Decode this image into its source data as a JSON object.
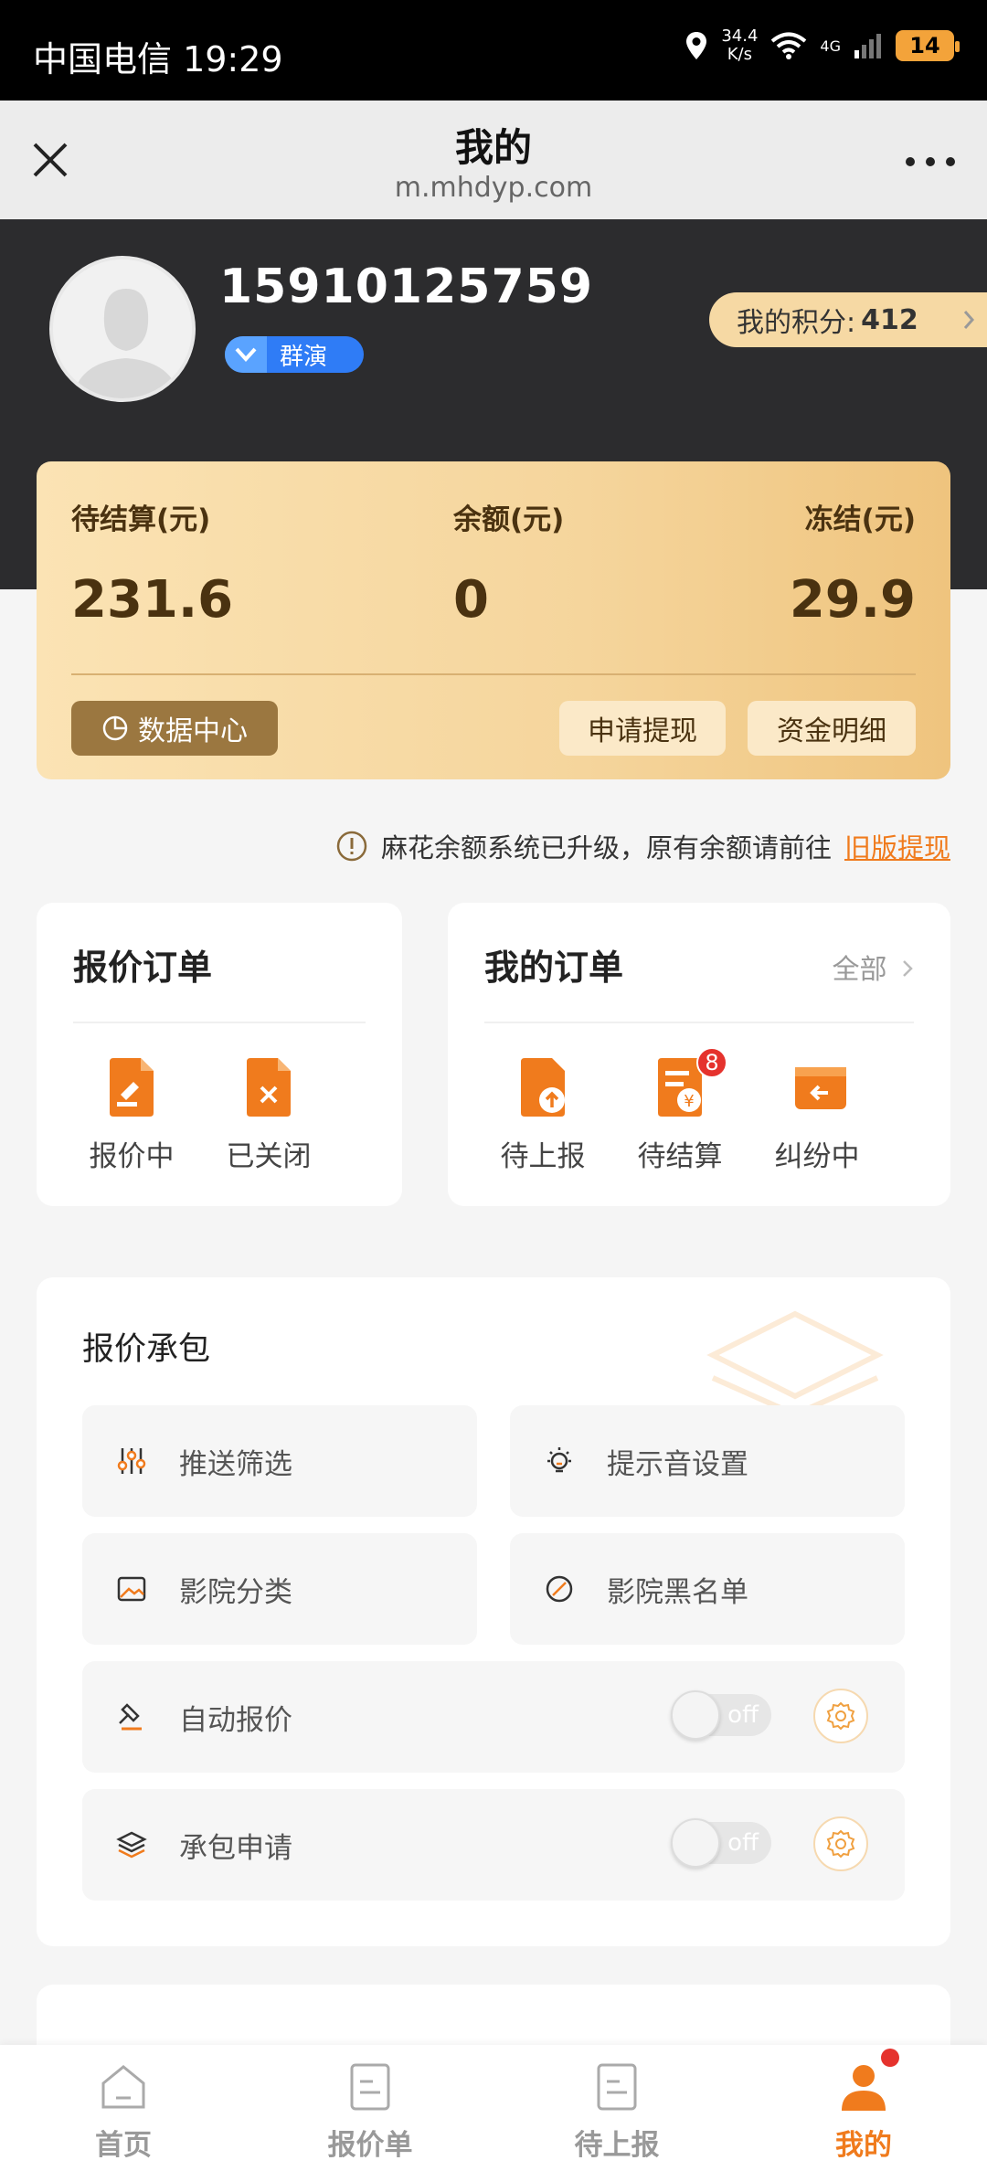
{
  "status_bar": {
    "carrier_time": "中国电信 19:29",
    "speed_value": "34.4",
    "speed_unit": "K/s",
    "network": "4G",
    "battery": "14"
  },
  "titlebar": {
    "title": "我的",
    "url": "m.mhdyp.com"
  },
  "profile": {
    "phone": "15910125759",
    "badge": "群演",
    "points_label": "我的积分:",
    "points_value": "412"
  },
  "balance_card": {
    "pending_label": "待结算(元)",
    "pending_value": "231.6",
    "balance_label": "余额(元)",
    "balance_value": "0",
    "frozen_label": "冻结(元)",
    "frozen_value": "29.9",
    "data_center": "数据中心",
    "withdraw": "申请提现",
    "details": "资金明细"
  },
  "notice": {
    "text": "麻花余额系统已升级，原有余额请前往",
    "link": "旧版提现"
  },
  "quote_orders": {
    "title": "报价订单",
    "items": [
      "报价中",
      "已关闭"
    ]
  },
  "my_orders": {
    "title": "我的订单",
    "all": "全部",
    "items": [
      "待上报",
      "待结算",
      "纠纷中"
    ],
    "badge": "8"
  },
  "contract": {
    "title": "报价承包",
    "options": {
      "push_filter": "推送筛选",
      "sound": "提示音设置",
      "cinema_category": "影院分类",
      "cinema_blacklist": "影院黑名单",
      "auto_quote": "自动报价",
      "contract_apply": "承包申请"
    },
    "toggle_off": "off",
    "auto_quote_on": false,
    "contract_apply_on": false
  },
  "nav": {
    "home": "首页",
    "quotes": "报价单",
    "pending": "待上报",
    "mine": "我的",
    "active": "mine"
  },
  "colors": {
    "accent": "#f07b1d",
    "dark_header": "#2c2c2e",
    "gold": "#f5d59c",
    "badge_red": "#e5322d"
  }
}
